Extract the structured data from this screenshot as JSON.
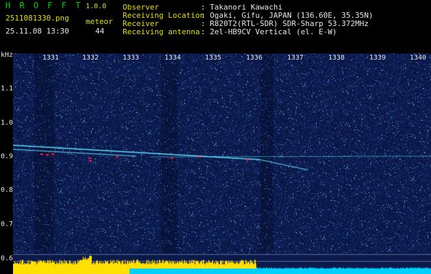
{
  "app": {
    "name": "H R O F F T",
    "version": "1.0.0"
  },
  "file": {
    "name": "2511081330.png",
    "datetime": "25.11.08 13:30"
  },
  "meteor": {
    "label": "meteor",
    "count": "44"
  },
  "info": [
    {
      "label": "Observer",
      "value": ": Takanori Kawachi"
    },
    {
      "label": "Receiving Location",
      "value": ": Ogaki, Gifu, JAPAN (136.60E, 35.35N)"
    },
    {
      "label": "Receiver",
      "value": ": R820T2(RTL-SDR) SDR-Sharp 53.372MHz"
    },
    {
      "label": "Receiving antenna",
      "value": ": 2el-HB9CV Vertical (el. E-W)"
    }
  ],
  "axis": {
    "y_unit": "kHz",
    "y_ticks": [
      "1.1",
      "1.0",
      "0.9",
      "0.8",
      "0.7",
      "0.6"
    ],
    "x_ticks": [
      "1331",
      "1332",
      "1333",
      "1334",
      "1335",
      "1336",
      "1337",
      "1338",
      "1339",
      "1340"
    ]
  },
  "colors": {
    "background": "#000000",
    "spectrogram_bg": "#0b1a4a",
    "title_green": "#00d000",
    "label_yellow": "#e0e000",
    "signal_cyan": "#60e0ff",
    "meteor_red": "#ff2040",
    "level_yellow": "#ffe000",
    "level_cyan": "#00d0ff"
  }
}
